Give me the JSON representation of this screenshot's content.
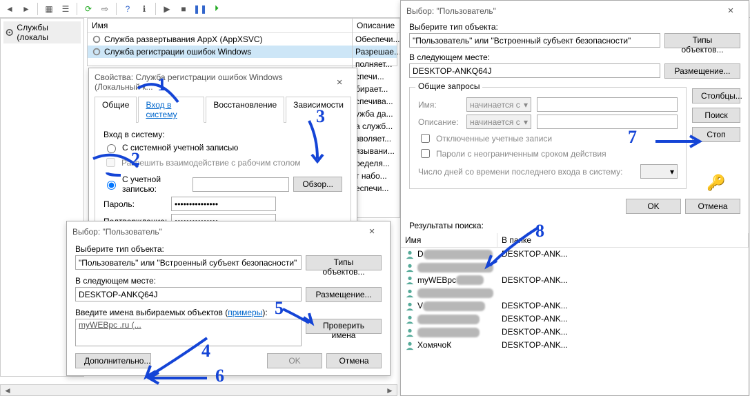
{
  "toolbar_icons": [
    "back",
    "forward",
    "sep",
    "grid",
    "list",
    "sep",
    "refresh",
    "export",
    "sep",
    "help",
    "info",
    "sep",
    "play",
    "stop",
    "pause",
    "resume"
  ],
  "sidebar": {
    "label": "Службы (локалы"
  },
  "services": {
    "col_name": "Имя",
    "col_desc": "Описание",
    "rows": [
      {
        "name": "Служба развертывания AppX (AppXSVC)",
        "desc": "Обеспечи..."
      },
      {
        "name": "Служба регистрации ошибок Windows",
        "desc": "Разрешае..."
      }
    ],
    "desc_tail": [
      "полняет...",
      "спечи...",
      "бирает...",
      "спечива...",
      "ужба да...",
      "а служб...",
      "зволяет...",
      "язывани...",
      "ределя...",
      "т набо...",
      "еспечи..."
    ]
  },
  "props": {
    "title": "Свойства: Служба регистрации ошибок Windows (Локальный к...",
    "tabs": {
      "general": "Общие",
      "logon": "Вход в систему",
      "recovery": "Восстановление",
      "deps": "Зависимости"
    },
    "logon_label": "Вход в систему:",
    "radio_system": "С системной учетной записью",
    "chk_desktop": "Разрешить взаимодействие с рабочим столом",
    "radio_account": "С учетной записью:",
    "browse": "Обзор...",
    "password": "Пароль:",
    "confirm": "Подтверждение:",
    "pw_mask": "•••••••••••••••"
  },
  "select1": {
    "title": "Выбор: \"Пользователь\"",
    "obj_label": "Выберите тип объекта:",
    "obj_value": "\"Пользователь\" или \"Встроенный субъект безопасности\"",
    "types_btn": "Типы объектов...",
    "loc_label": "В следующем месте:",
    "loc_value": "DESKTOP-ANKQ64J",
    "loc_btn": "Размещение...",
    "names_label_a": "Введите имена выбираемых объектов (",
    "names_label_link": "примеры",
    "names_label_b": "):",
    "names_value": "myWEBpc .ru (...",
    "check_btn": "Проверить имена",
    "advanced": "Дополнительно...",
    "ok": "OK",
    "cancel": "Отмена"
  },
  "select2": {
    "title": "Выбор: \"Пользователь\"",
    "obj_label": "Выберите тип объекта:",
    "obj_value": "\"Пользователь\" или \"Встроенный субъект безопасности\"",
    "types_btn": "Типы объектов...",
    "loc_label": "В следующем месте:",
    "loc_value": "DESKTOP-ANKQ64J",
    "loc_btn": "Размещение...",
    "group_title": "Общие запросы",
    "name_lbl": "Имя:",
    "desc_lbl": "Описание:",
    "starts": "начинается с",
    "chk_disabled": "Отключенные учетные записи",
    "chk_pwnever": "Пароли с неограниченным сроком действия",
    "days_lbl": "Число дней со времени последнего входа в систему:",
    "columns": "Столбцы...",
    "find": "Поиск",
    "stop": "Стоп",
    "ok": "OK",
    "cancel": "Отмена",
    "results_lbl": "Результаты поиска:",
    "col_name": "Имя",
    "col_folder": "В папке",
    "rows": [
      {
        "name": "D",
        "folder": "DESKTOP-ANK...",
        "smudge": 100
      },
      {
        "name": "",
        "folder": "",
        "smudge": 110
      },
      {
        "name": "myWEBpc",
        "folder": "DESKTOP-ANK...",
        "smudge": 40
      },
      {
        "name": "",
        "folder": "",
        "smudge": 110
      },
      {
        "name": "V",
        "folder": "DESKTOP-ANK...",
        "smudge": 90
      },
      {
        "name": "",
        "folder": "DESKTOP-ANK...",
        "smudge": 90
      },
      {
        "name": "",
        "folder": "DESKTOP-ANK...",
        "smudge": 90
      },
      {
        "name": "ХомячоК",
        "folder": "DESKTOP-ANK...",
        "smudge": 0
      }
    ]
  },
  "annotations": {
    "n1": "1",
    "n2": "2",
    "n3": "3",
    "n4": "4",
    "n5": "5",
    "n6": "6",
    "n7": "7",
    "n8": "8"
  }
}
